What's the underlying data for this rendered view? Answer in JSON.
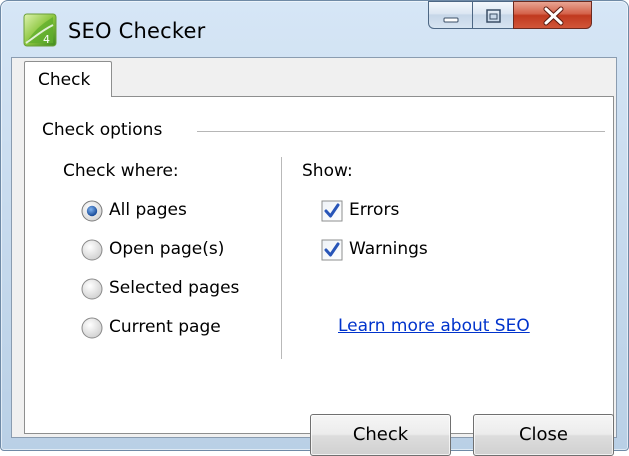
{
  "window": {
    "title": "SEO Checker",
    "icon": "seo-checker-app-icon",
    "controls": [
      "minimize-icon",
      "maximize-icon",
      "close-icon"
    ]
  },
  "tabs": [
    {
      "label": "Check",
      "selected": true
    }
  ],
  "check_options": {
    "group_label": "Check options",
    "check_where": {
      "heading": "Check where:",
      "options": [
        {
          "label": "All pages",
          "selected": true
        },
        {
          "label": "Open page(s)",
          "selected": false
        },
        {
          "label": "Selected pages",
          "selected": false
        },
        {
          "label": "Current page",
          "selected": false
        }
      ]
    },
    "show": {
      "heading": "Show:",
      "options": [
        {
          "label": "Errors",
          "checked": true
        },
        {
          "label": "Warnings",
          "checked": true
        }
      ],
      "link_text": "Learn more about SEO"
    }
  },
  "buttons": {
    "check_label": "Check",
    "close_label": "Close"
  },
  "colors": {
    "link": "#0033cc",
    "checkmark": "#2855b8",
    "radio_selected": "#1c4f9c",
    "close_button": "#c0391f"
  }
}
